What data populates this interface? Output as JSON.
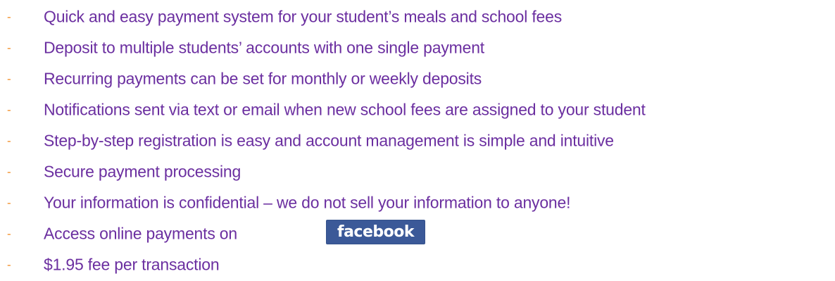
{
  "colors": {
    "text": "#6b2fa0",
    "dash": "#f28c24",
    "facebook": "#3b5998"
  },
  "features": [
    {
      "dash": "-",
      "text": "Quick and easy payment system for your student’s meals and school fees"
    },
    {
      "dash": "-",
      "text": "Deposit to multiple students’ accounts with one single payment"
    },
    {
      "dash": "-",
      "text": "Recurring payments can be set for monthly or weekly deposits"
    },
    {
      "dash": "-",
      "text": "Notifications sent via text or email when new school fees are assigned to your student"
    },
    {
      "dash": "-",
      "text": "Step-by-step registration is easy and account management is simple and intuitive"
    },
    {
      "dash": "-",
      "text": "Secure payment processing"
    },
    {
      "dash": "-",
      "text": "Your information is confidential – we do not sell your information to anyone!"
    },
    {
      "dash": "-",
      "text": "Access online payments on",
      "badge": "facebook"
    },
    {
      "dash": "-",
      "text": "$1.95 fee per transaction"
    }
  ]
}
